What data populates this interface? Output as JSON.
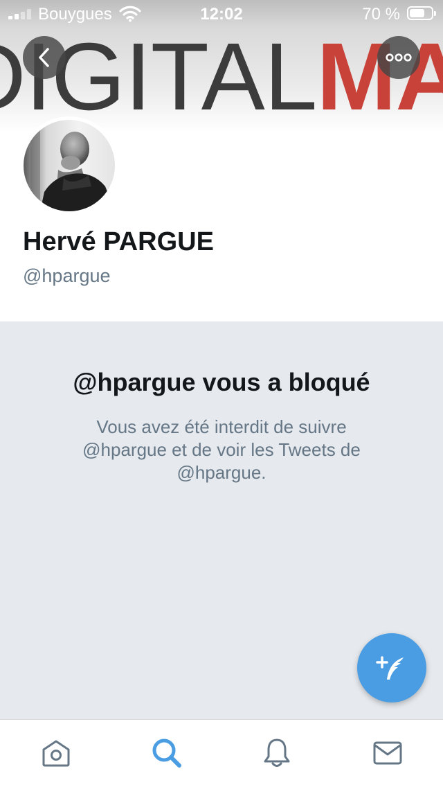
{
  "status_bar": {
    "carrier": "Bouygues",
    "time": "12:02",
    "battery_percent": "70 %",
    "battery_level": 0.7
  },
  "banner": {
    "text_part1": "DIGITAL",
    "text_part2": "MA"
  },
  "profile": {
    "name": "Hervé PARGUE",
    "handle": "@hpargue"
  },
  "blocked": {
    "title": "@hpargue vous a bloqué",
    "message": "Vous avez été interdit de suivre @hpargue et de voir les Tweets de @hpargue."
  },
  "colors": {
    "accent": "#4a9de3",
    "text_primary": "#14171a",
    "text_secondary": "#657786",
    "panel_bg": "#e6e9ed"
  },
  "tabs": [
    {
      "icon": "home-icon",
      "active": false
    },
    {
      "icon": "search-icon",
      "active": true
    },
    {
      "icon": "bell-icon",
      "active": false
    },
    {
      "icon": "mail-icon",
      "active": false
    }
  ]
}
